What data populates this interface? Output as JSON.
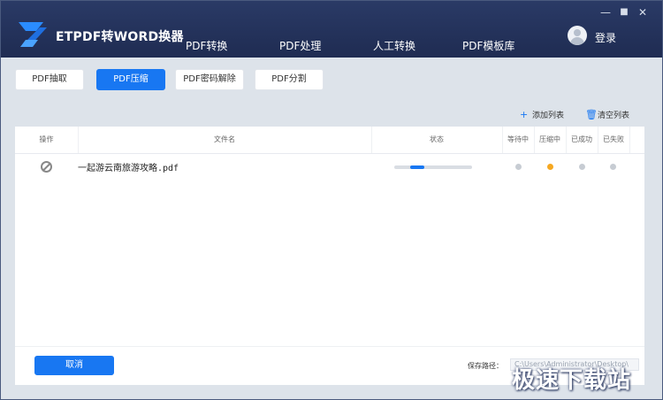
{
  "app": {
    "title": "ETPDF转WORD换器"
  },
  "nav": {
    "tabs": [
      {
        "label": "PDF转换",
        "active": false
      },
      {
        "label": "PDF处理",
        "active": true
      },
      {
        "label": "人工转换",
        "active": false
      },
      {
        "label": "PDF模板库",
        "active": false
      }
    ]
  },
  "window_controls": {
    "minimize": "—",
    "maximize": "■",
    "close": "✕"
  },
  "user": {
    "login_label": "登录",
    "avatar_icon": "user-avatar-icon"
  },
  "subtabs": [
    {
      "label": "PDF抽取",
      "active": false
    },
    {
      "label": "PDF压缩",
      "active": true
    },
    {
      "label": "PDF密码解除",
      "active": false
    },
    {
      "label": "PDF分割",
      "active": false
    }
  ],
  "toolbar": {
    "add_label": "添加列表",
    "clear_label": "清空列表"
  },
  "table": {
    "headers": {
      "op": "操作",
      "filename": "文件名",
      "status": "状态",
      "waiting": "等待中",
      "compressing": "压缩中",
      "success": "已成功",
      "failed": "已失败"
    },
    "rows": [
      {
        "filename": "一起游云南旅游攻略.pdf",
        "progress": 0.2,
        "stage": "compressing"
      }
    ]
  },
  "footer": {
    "cancel_label": "取消",
    "save_path_label": "保存路径：",
    "save_path_value": "C:\\Users\\Administrator\\Desktop\\"
  },
  "watermark": "极速下载站",
  "colors": {
    "accent": "#1877f2",
    "active_dot": "#f6a821",
    "header_bg": "#1f2c52",
    "content_bg": "#dde3ea"
  }
}
